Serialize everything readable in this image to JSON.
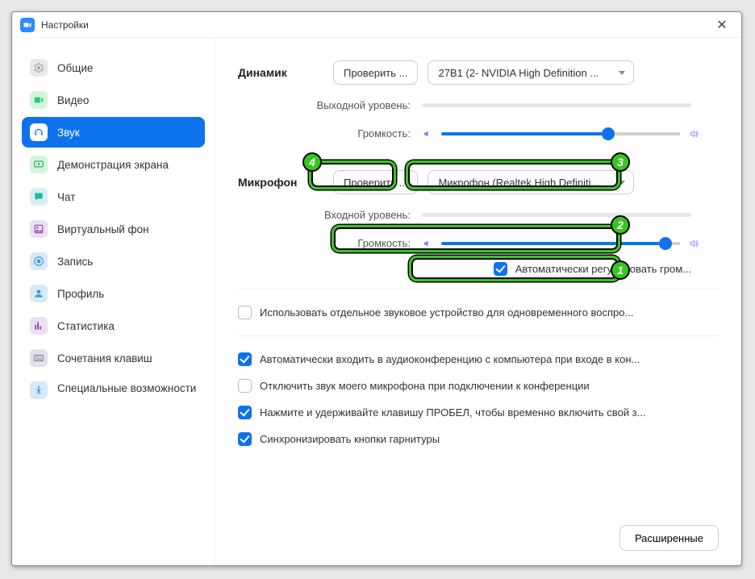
{
  "window": {
    "title": "Настройки"
  },
  "sidebar": {
    "items": [
      {
        "label": "Общие"
      },
      {
        "label": "Видео"
      },
      {
        "label": "Звук"
      },
      {
        "label": "Демонстрация экрана"
      },
      {
        "label": "Чат"
      },
      {
        "label": "Виртуальный фон"
      },
      {
        "label": "Запись"
      },
      {
        "label": "Профиль"
      },
      {
        "label": "Статистика"
      },
      {
        "label": "Сочетания клавиш"
      },
      {
        "label": "Специальные возможности"
      }
    ]
  },
  "speaker": {
    "section_label": "Динамик",
    "test_button": "Проверить ...",
    "device": "27B1 (2- NVIDIA High Definition ...",
    "output_level_label": "Выходной уровень:",
    "volume_label": "Громкость:",
    "volume_percent": 70
  },
  "mic": {
    "section_label": "Микрофон",
    "test_button": "Проверить ...",
    "device": "Микрофон (Realtek High Definiti...",
    "input_level_label": "Входной уровень:",
    "volume_label": "Громкость:",
    "volume_percent": 94,
    "auto_gain_label": "Автоматически регулировать гром...",
    "auto_gain_checked": true
  },
  "options": {
    "separate_device": {
      "label": "Использовать отдельное звуковое устройство для одновременного воспро...",
      "checked": false
    },
    "auto_join_audio": {
      "label": "Автоматически входить в аудиоконференцию с компьютера при входе в кон...",
      "checked": true
    },
    "mute_on_join": {
      "label": "Отключить звук моего микрофона при подключении к конференции",
      "checked": false
    },
    "push_to_talk": {
      "label": "Нажмите и удерживайте клавишу ПРОБЕЛ, чтобы временно включить свой з...",
      "checked": true
    },
    "sync_headset": {
      "label": "Синхронизировать кнопки гарнитуры",
      "checked": true
    }
  },
  "advanced_button": "Расширенные",
  "annotations": {
    "n1": "1",
    "n2": "2",
    "n3": "3",
    "n4": "4"
  }
}
